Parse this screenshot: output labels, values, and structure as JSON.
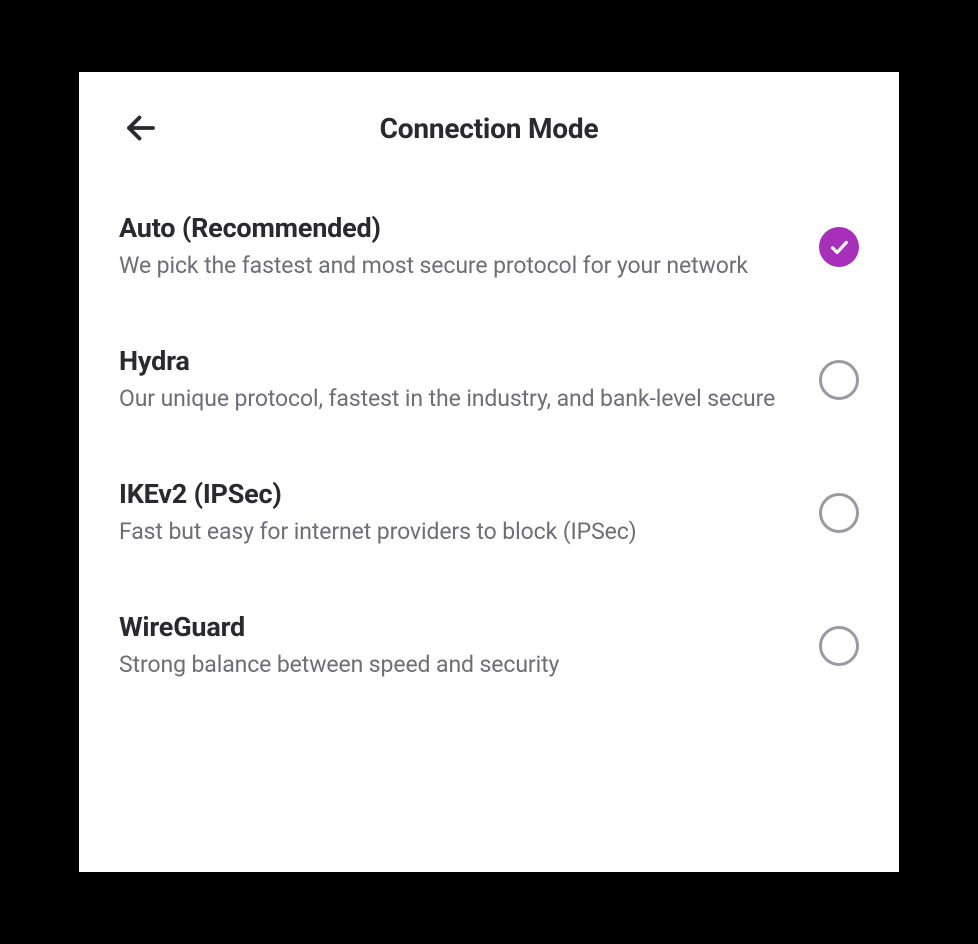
{
  "header": {
    "title": "Connection Mode"
  },
  "options": [
    {
      "title": "Auto (Recommended)",
      "desc": "We pick the fastest and most secure protocol for your network",
      "selected": true
    },
    {
      "title": "Hydra",
      "desc": "Our unique protocol, fastest in the industry, and bank-level secure",
      "selected": false
    },
    {
      "title": "IKEv2 (IPSec)",
      "desc": "Fast but easy for internet providers to block (IPSec)",
      "selected": false
    },
    {
      "title": "WireGuard",
      "desc": "Strong balance between speed and security",
      "selected": false
    }
  ],
  "colors": {
    "accent": "#a82fb9",
    "text_primary": "#2a2a2e",
    "text_secondary": "#6e6e76",
    "radio_border": "#9a9aa2"
  }
}
